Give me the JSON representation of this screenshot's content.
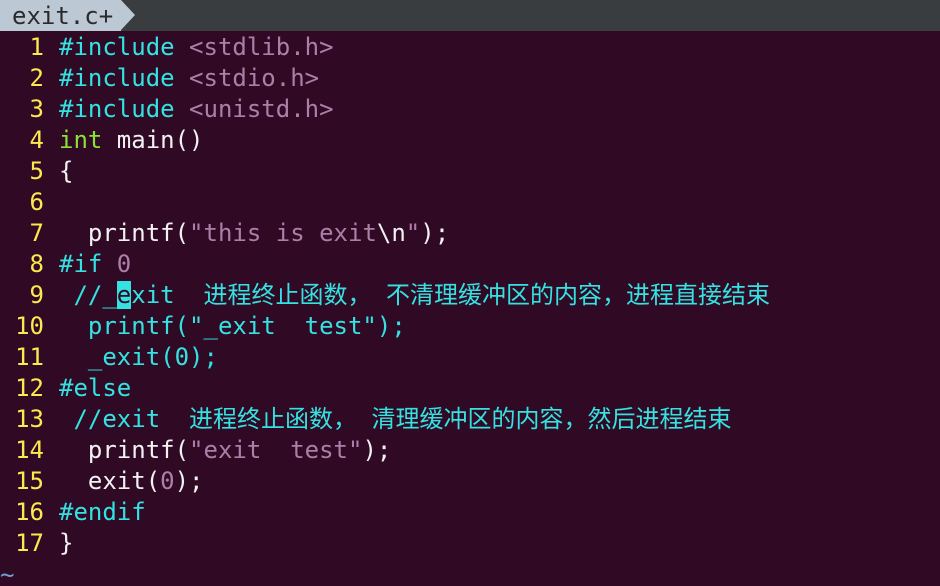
{
  "tab": {
    "filename": "exit.c+"
  },
  "lines": [
    {
      "n": "1",
      "segs": [
        {
          "c": "pre",
          "t": "#include "
        },
        {
          "c": "str",
          "t": "<stdlib.h>"
        }
      ]
    },
    {
      "n": "2",
      "segs": [
        {
          "c": "pre",
          "t": "#include "
        },
        {
          "c": "str",
          "t": "<stdio.h>"
        }
      ]
    },
    {
      "n": "3",
      "segs": [
        {
          "c": "pre",
          "t": "#include "
        },
        {
          "c": "str",
          "t": "<unistd.h>"
        }
      ]
    },
    {
      "n": "4",
      "segs": [
        {
          "c": "ty",
          "t": "int"
        },
        {
          "c": "plain",
          "t": " main()"
        }
      ]
    },
    {
      "n": "5",
      "segs": [
        {
          "c": "plain",
          "t": "{"
        }
      ]
    },
    {
      "n": "6",
      "segs": []
    },
    {
      "n": "7",
      "segs": [
        {
          "c": "plain",
          "t": "  printf("
        },
        {
          "c": "str",
          "t": "\"this is exit"
        },
        {
          "c": "plain",
          "t": "\\n"
        },
        {
          "c": "str",
          "t": "\""
        },
        {
          "c": "plain",
          "t": ");"
        }
      ]
    },
    {
      "n": "8",
      "segs": [
        {
          "c": "pre",
          "t": "#if "
        },
        {
          "c": "str",
          "t": "0"
        }
      ]
    },
    {
      "n": "9",
      "segs": [
        {
          "c": "cm",
          "t": " //_"
        },
        {
          "c": "cursor",
          "t": "e"
        },
        {
          "c": "cm",
          "t": "xit  进程终止函数， 不清理缓冲区的内容，进程直接结束"
        }
      ]
    },
    {
      "n": "10",
      "segs": [
        {
          "c": "cm",
          "t": "  printf(\"_exit  test\");"
        }
      ]
    },
    {
      "n": "11",
      "segs": [
        {
          "c": "cm",
          "t": "  _exit(0);"
        }
      ]
    },
    {
      "n": "12",
      "segs": [
        {
          "c": "pre",
          "t": "#else"
        }
      ]
    },
    {
      "n": "13",
      "segs": [
        {
          "c": "cm",
          "t": " //exit  进程终止函数， 清理缓冲区的内容，然后进程结束"
        }
      ]
    },
    {
      "n": "14",
      "segs": [
        {
          "c": "plain",
          "t": "  printf("
        },
        {
          "c": "str",
          "t": "\"exit  test\""
        },
        {
          "c": "plain",
          "t": ");"
        }
      ]
    },
    {
      "n": "15",
      "segs": [
        {
          "c": "plain",
          "t": "  exit("
        },
        {
          "c": "str",
          "t": "0"
        },
        {
          "c": "plain",
          "t": ");"
        }
      ]
    },
    {
      "n": "16",
      "segs": [
        {
          "c": "pre",
          "t": "#endif"
        }
      ]
    },
    {
      "n": "17",
      "segs": [
        {
          "c": "plain",
          "t": "}"
        }
      ]
    }
  ],
  "empty_line_marker": "~",
  "colors": {
    "background": "#300a24",
    "line_number": "#fce94f",
    "preprocessor": "#34e2e2",
    "string": "#ad7fa8",
    "comment": "#34e2e2",
    "type": "#8ae234",
    "tab_bg": "#bcc8d4"
  }
}
